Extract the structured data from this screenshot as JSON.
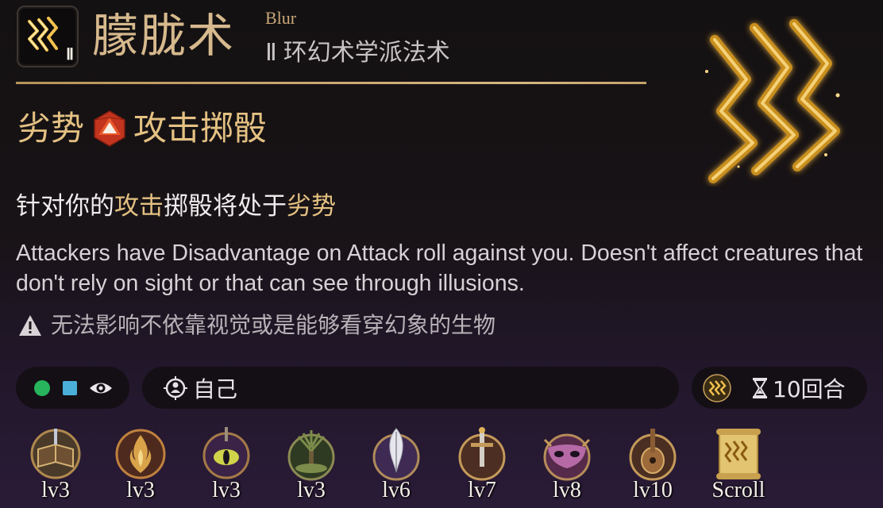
{
  "spell": {
    "name_zh": "朦胧术",
    "name_en": "Blur",
    "level_badge": "Ⅱ",
    "school_roman": "Ⅱ",
    "school": "环幻术学派法术"
  },
  "effect": {
    "condition": "劣势",
    "roll": "攻击掷骰"
  },
  "description": {
    "zh_part1": "针对你的",
    "zh_attack": "攻击",
    "zh_part2": "掷骰将处于",
    "zh_disadvantage": "劣势",
    "en": "Attackers have Disadvantage on Attack roll against you. Doesn't affect creatures that don't rely on sight or that can see through illusions."
  },
  "warning": {
    "text": "无法影响不依靠视觉或是能够看穿幻象的生物",
    "icon": "warning-triangle-icon"
  },
  "pills": {
    "target": "自己",
    "duration": "10回合"
  },
  "classes": [
    {
      "icon": "wizard-book-icon",
      "label": "lv3"
    },
    {
      "icon": "sorcerer-flame-icon",
      "label": "lv3"
    },
    {
      "icon": "warlock-eye-icon",
      "label": "lv3"
    },
    {
      "icon": "druid-tree-icon",
      "label": "lv3"
    },
    {
      "icon": "bard-quill-icon",
      "label": "lv6"
    },
    {
      "icon": "cleric-sword-icon",
      "label": "lv7"
    },
    {
      "icon": "trickster-mask-icon",
      "label": "lv8"
    },
    {
      "icon": "bard-lute-icon",
      "label": "lv10"
    },
    {
      "icon": "scroll-icon",
      "label": "Scroll"
    }
  ],
  "colors": {
    "gold": "#e4c182",
    "title_gold": "#d6b98d",
    "green_dot": "#27b45c",
    "blue_square": "#4aaed8"
  }
}
